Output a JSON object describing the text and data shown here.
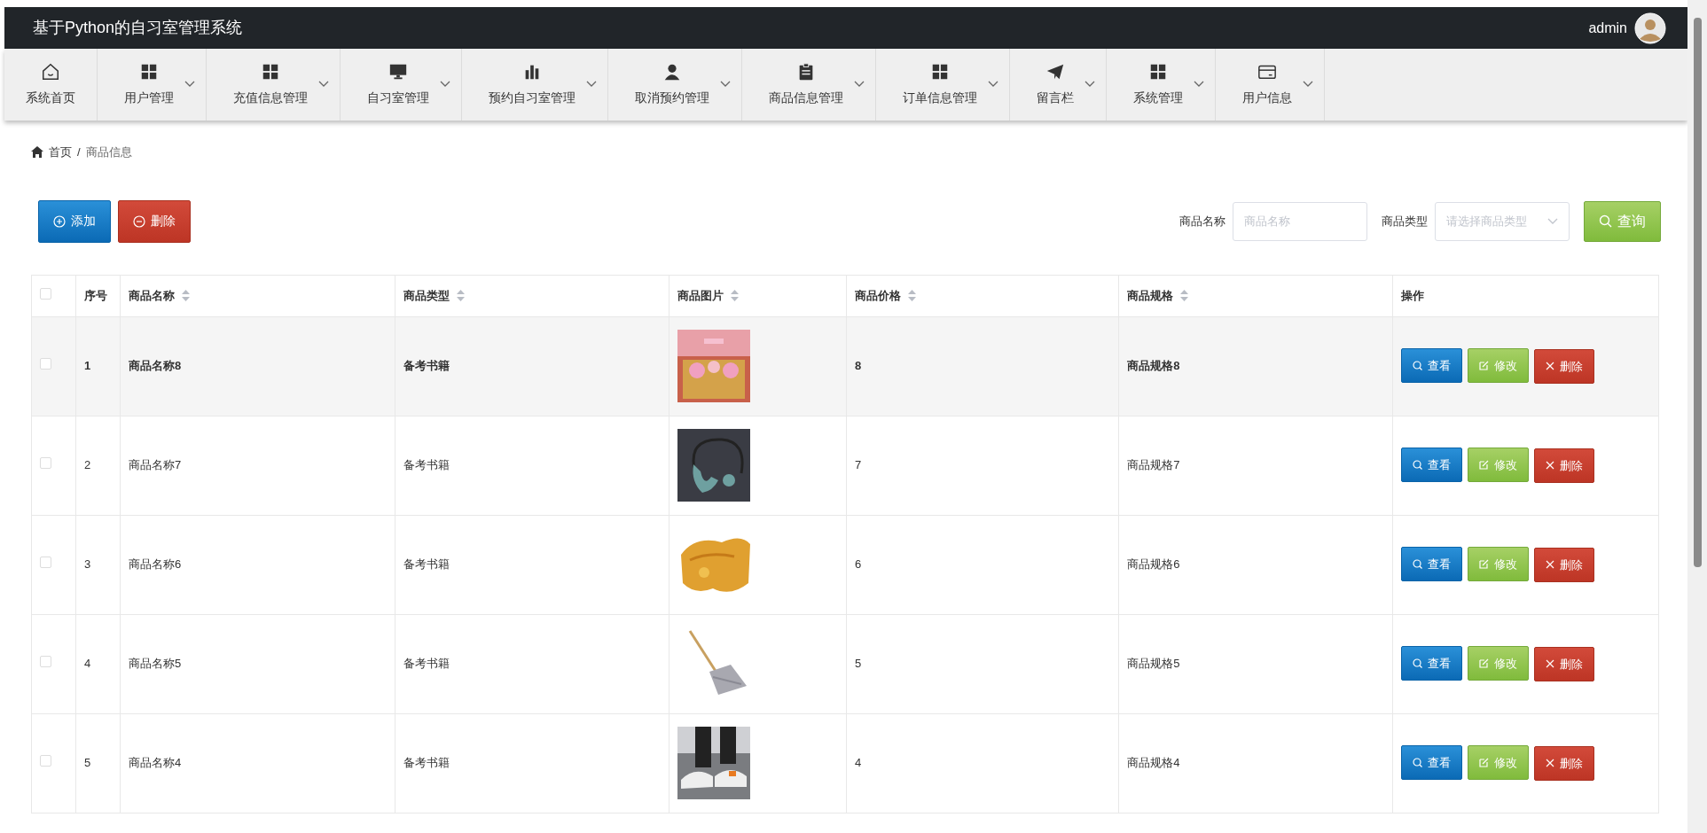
{
  "header": {
    "title": "基于Python的自习室管理系统",
    "user": "admin"
  },
  "nav": [
    {
      "label": "系统首页",
      "dropdown": false
    },
    {
      "label": "用户管理",
      "dropdown": true
    },
    {
      "label": "充值信息管理",
      "dropdown": true
    },
    {
      "label": "自习室管理",
      "dropdown": true
    },
    {
      "label": "预约自习室管理",
      "dropdown": true
    },
    {
      "label": "取消预约管理",
      "dropdown": true
    },
    {
      "label": "商品信息管理",
      "dropdown": true
    },
    {
      "label": "订单信息管理",
      "dropdown": true
    },
    {
      "label": "留言栏",
      "dropdown": true
    },
    {
      "label": "系统管理",
      "dropdown": true
    },
    {
      "label": "用户信息",
      "dropdown": true
    }
  ],
  "breadcrumb": {
    "items": [
      "首页",
      "商品信息"
    ],
    "separator": "/"
  },
  "toolbar": {
    "add": "添加",
    "delete": "删除"
  },
  "search": {
    "name_label": "商品名称",
    "name_placeholder": "商品名称",
    "type_label": "商品类型",
    "type_placeholder": "请选择商品类型",
    "button": "查询"
  },
  "table": {
    "select_all_checked": false,
    "columns": [
      {
        "label": "序号",
        "sortable": false
      },
      {
        "label": "商品名称",
        "sortable": true
      },
      {
        "label": "商品类型",
        "sortable": true
      },
      {
        "label": "商品图片",
        "sortable": true
      },
      {
        "label": "商品价格",
        "sortable": true
      },
      {
        "label": "商品规格",
        "sortable": true
      },
      {
        "label": "操作",
        "sortable": false
      }
    ],
    "rows": [
      {
        "index": "1",
        "name": "商品名称8",
        "type": "备考书籍",
        "price": "8",
        "spec": "商品规格8",
        "checked": false,
        "highlighted": true,
        "actions": {
          "view": "查看",
          "edit": "修改",
          "delete": "删除"
        }
      },
      {
        "index": "2",
        "name": "商品名称7",
        "type": "备考书籍",
        "price": "7",
        "spec": "商品规格7",
        "checked": false,
        "highlighted": false,
        "actions": {
          "view": "查看",
          "edit": "修改",
          "delete": "删除"
        }
      },
      {
        "index": "3",
        "name": "商品名称6",
        "type": "备考书籍",
        "price": "6",
        "spec": "商品规格6",
        "checked": false,
        "highlighted": false,
        "actions": {
          "view": "查看",
          "edit": "修改",
          "delete": "删除"
        }
      },
      {
        "index": "4",
        "name": "商品名称5",
        "type": "备考书籍",
        "price": "5",
        "spec": "商品规格5",
        "checked": false,
        "highlighted": false,
        "actions": {
          "view": "查看",
          "edit": "修改",
          "delete": "删除"
        }
      },
      {
        "index": "5",
        "name": "商品名称4",
        "type": "备考书籍",
        "price": "4",
        "spec": "商品规格4",
        "checked": false,
        "highlighted": false,
        "actions": {
          "view": "查看",
          "edit": "修改",
          "delete": "删除"
        }
      }
    ]
  }
}
